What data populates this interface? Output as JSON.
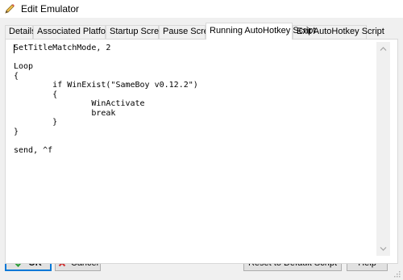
{
  "window": {
    "title": "Edit Emulator",
    "icon": "pencil-icon"
  },
  "tabs": [
    {
      "label": "Details",
      "active": false
    },
    {
      "label": "Associated Platforms",
      "active": false
    },
    {
      "label": "Startup Screen",
      "active": false
    },
    {
      "label": "Pause Screen",
      "active": false
    },
    {
      "label": "Running AutoHotkey Script",
      "active": true
    },
    {
      "label": "Exit AutoHotkey Script",
      "active": false
    }
  ],
  "editor": {
    "script": "SetTitleMatchMode, 2\n\nLoop\n{\n\tif WinExist(\"SameBoy v0.12.2\")\n\t{\n\t\tWinActivate\n\t\tbreak\n\t}\n}\n\nsend, ^f"
  },
  "buttons": {
    "ok_label": "OK",
    "cancel_label": "Cancel",
    "reset_label": "Reset to Default Script",
    "help_label": "Help"
  },
  "colors": {
    "ok_check": "#2e9e3a",
    "cancel_x": "#d03030",
    "focus_border": "#0078d7"
  }
}
